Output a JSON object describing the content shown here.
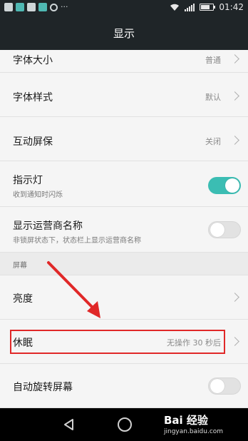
{
  "status_bar": {
    "time": "01:42",
    "battery_level": 0.75,
    "left_icons": [
      "image-icon",
      "notification-icon",
      "message-icon",
      "notification-icon",
      "sync-icon"
    ],
    "more_indicator": "···"
  },
  "title_bar": {
    "title": "显示"
  },
  "settings": {
    "font_size": {
      "label": "字体大小",
      "value": "普通"
    },
    "font_style": {
      "label": "字体样式",
      "value": "默认"
    },
    "screensaver": {
      "label": "互动屏保",
      "value": "关闭"
    },
    "indicator_light": {
      "label": "指示灯",
      "subtitle": "收到通知时闪烁",
      "enabled": true
    },
    "carrier_name": {
      "label": "显示运营商名称",
      "subtitle": "非锁屏状态下，状态栏上显示运营商名称",
      "enabled": false
    },
    "section_screen": {
      "label": "屏幕"
    },
    "brightness": {
      "label": "亮度"
    },
    "sleep": {
      "label": "休眠",
      "value": "无操作 30 秒后"
    },
    "auto_rotate": {
      "label": "自动旋转屏幕",
      "enabled": false
    }
  },
  "colors": {
    "accent": "#3bbdb3",
    "annotation": "#e02828",
    "titlebar": "#1f2528"
  },
  "watermark": {
    "logo": "Bai 经验",
    "url": "jingyan.baidu.com"
  }
}
